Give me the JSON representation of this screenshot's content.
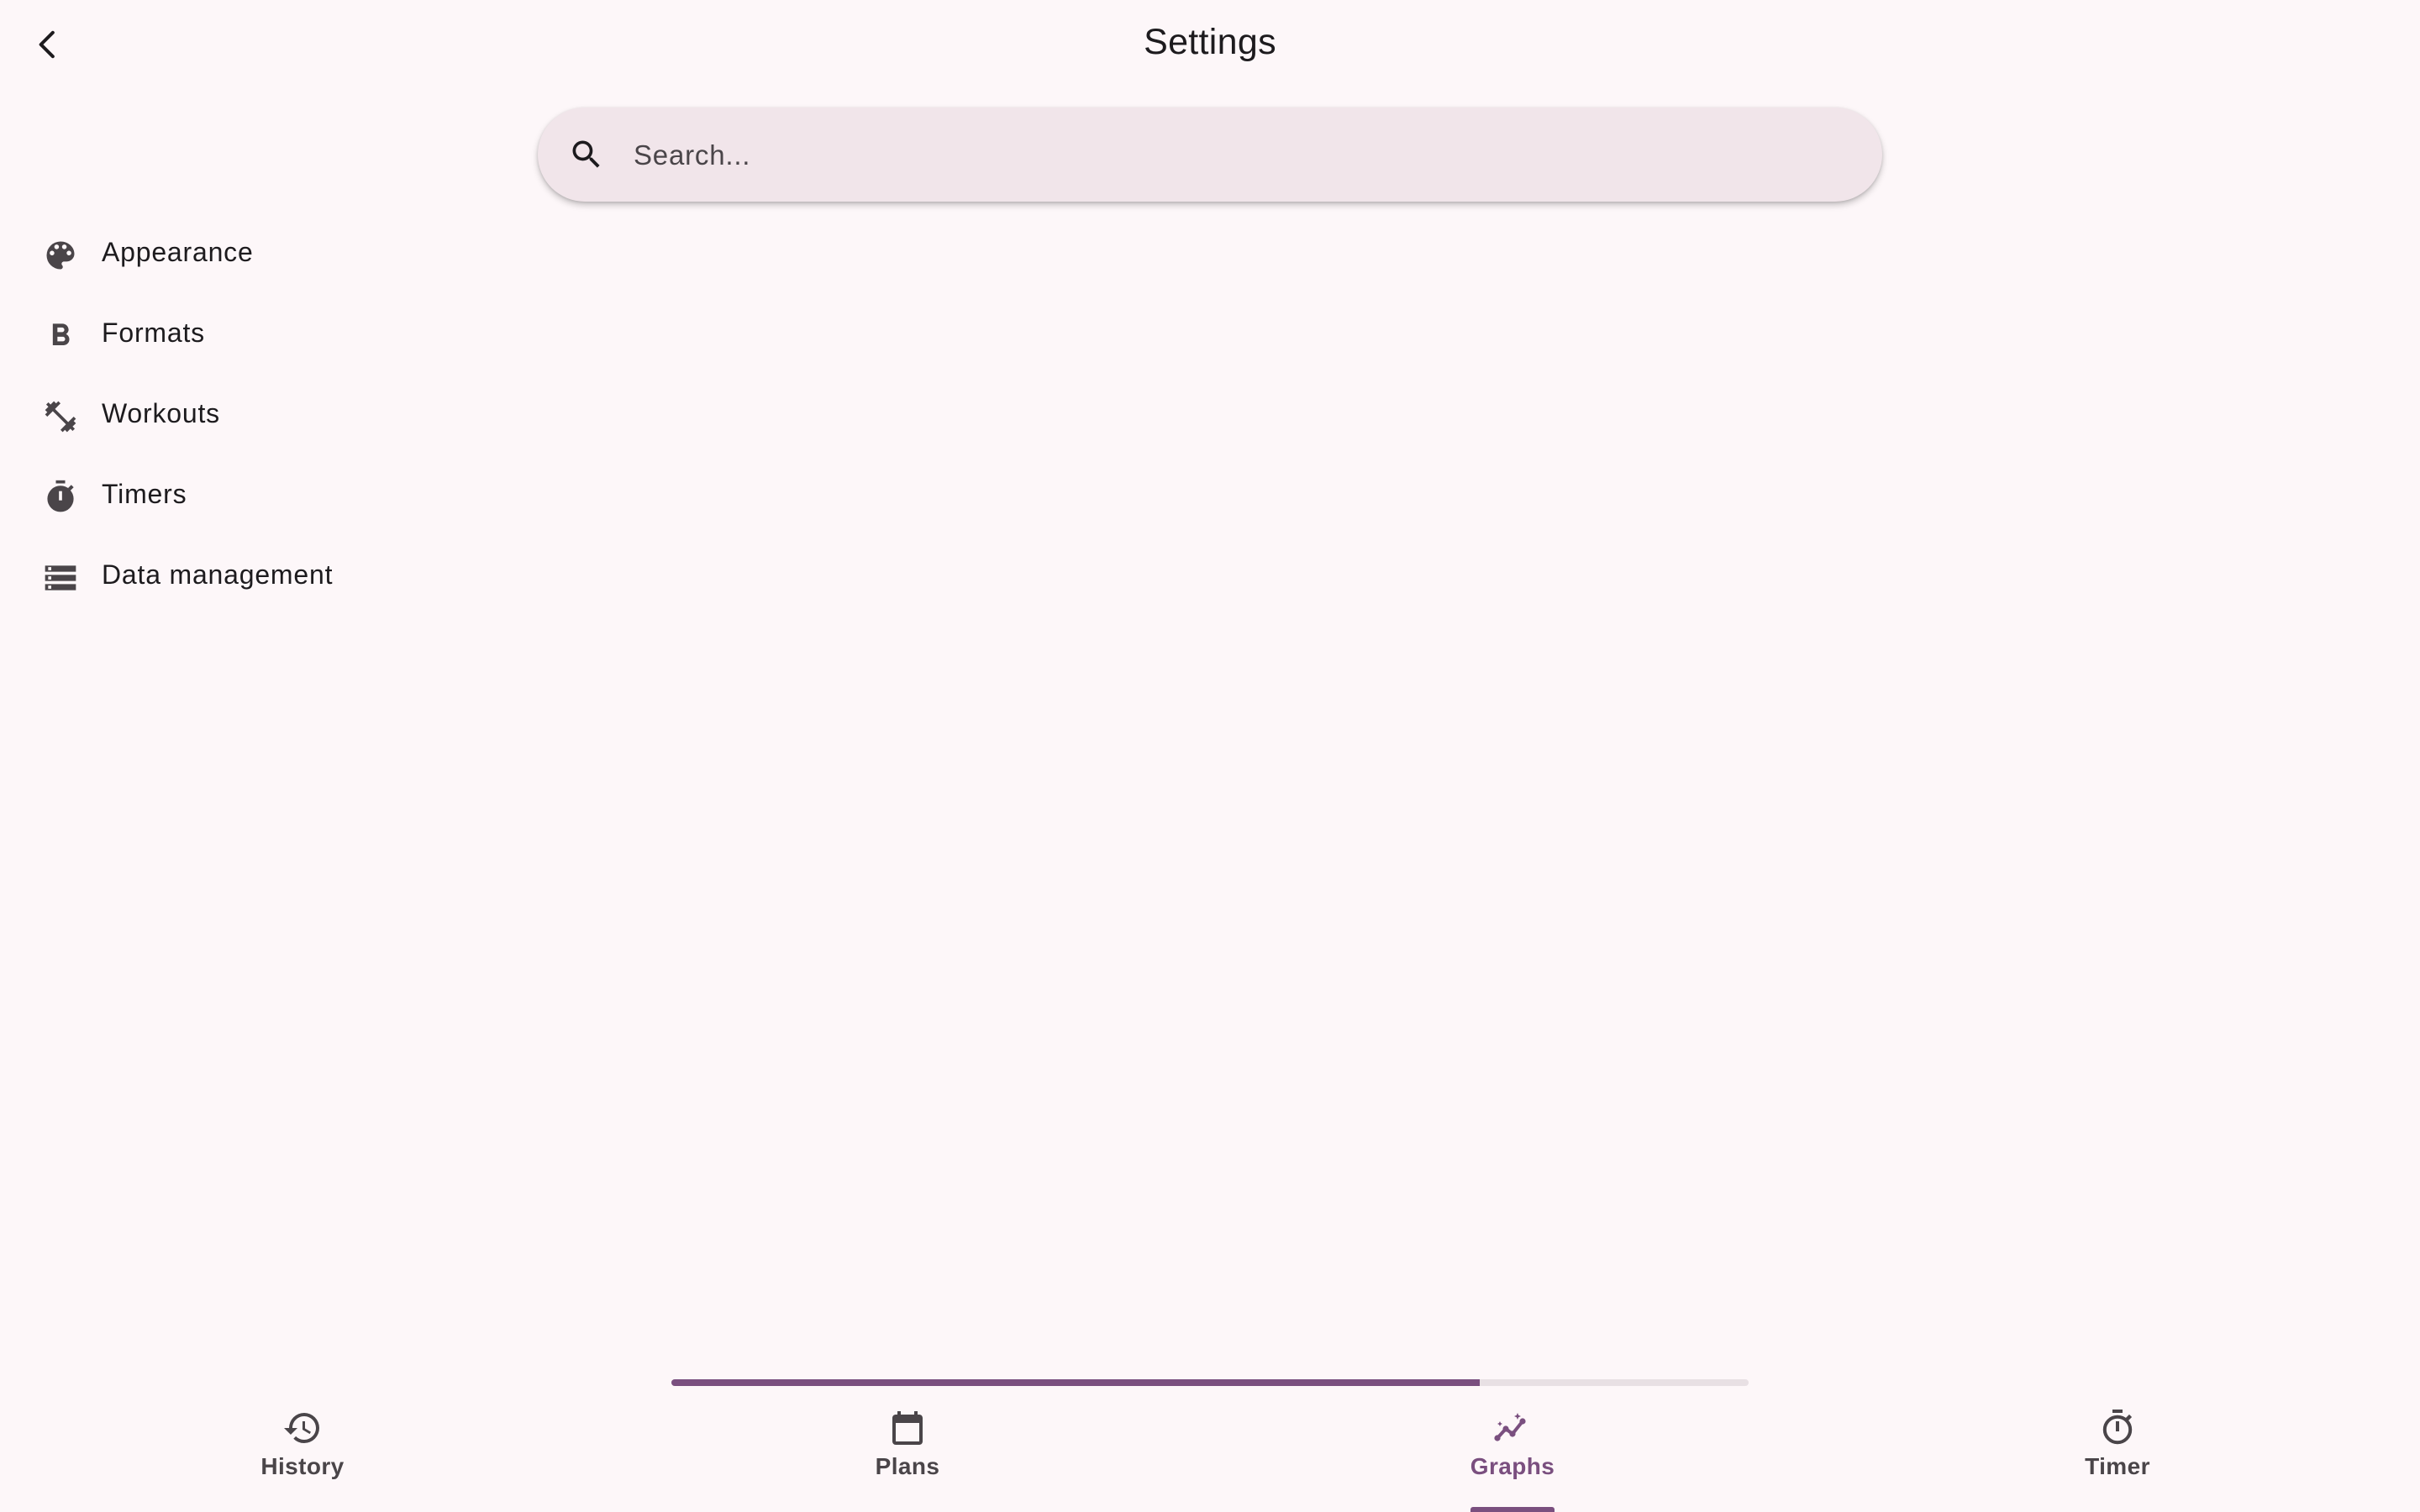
{
  "header": {
    "title": "Settings",
    "back_icon": "chevron-left-icon"
  },
  "search": {
    "placeholder": "Search...",
    "value": "",
    "icon": "search-icon"
  },
  "sidebar": {
    "items": [
      {
        "label": "Appearance",
        "icon": "palette-icon"
      },
      {
        "label": "Formats",
        "icon": "bold-b-icon"
      },
      {
        "label": "Workouts",
        "icon": "dumbbell-icon"
      },
      {
        "label": "Timers",
        "icon": "timer-icon"
      },
      {
        "label": "Data management",
        "icon": "storage-icon"
      }
    ]
  },
  "progress": {
    "fraction": 0.75
  },
  "bottom_nav": {
    "items": [
      {
        "label": "History",
        "icon": "history-icon",
        "active": false
      },
      {
        "label": "Plans",
        "icon": "calendar-icon",
        "active": false
      },
      {
        "label": "Graphs",
        "icon": "insights-icon",
        "active": true
      },
      {
        "label": "Timer",
        "icon": "timer-icon",
        "active": false
      }
    ]
  },
  "colors": {
    "background": "#fdf7f9",
    "accent": "#7a4f7f",
    "search_background": "#f1e5ea",
    "icon": "#4a4549",
    "text": "#1d1b1e"
  }
}
